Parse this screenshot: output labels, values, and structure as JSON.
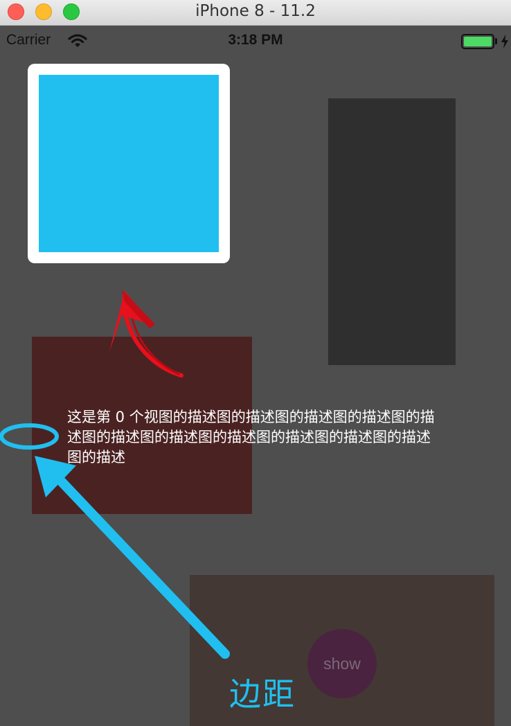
{
  "window": {
    "title": "iPhone 8 - 11.2"
  },
  "status_bar": {
    "carrier": "Carrier",
    "time": "3:18 PM",
    "battery_level": 1.0
  },
  "content": {
    "description": "这是第 0 个视图的描述图的描述图的描述图的描述图的描述图的描述图的描述图的描述图的描述图的描述图的描述图的描述",
    "show_button_label": "show"
  },
  "annotations": {
    "margin_label": "边距"
  },
  "colors": {
    "background": "#4e4e4e",
    "blue_square": "#20bff0",
    "dark_panel": "#2f2f2f",
    "maroon_panel": "#4b2222",
    "brown_panel": "#433833",
    "show_button": "#4a2340",
    "annotation_blue": "#20bff0",
    "annotation_red": "#e8101c"
  }
}
